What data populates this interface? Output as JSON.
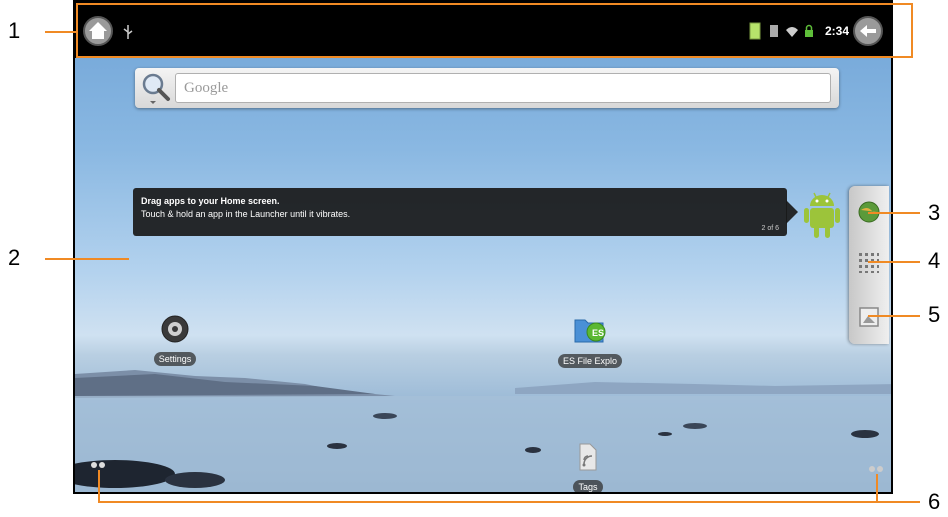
{
  "callouts": [
    "1",
    "2",
    "3",
    "4",
    "5",
    "6"
  ],
  "status_bar": {
    "time": "2:34",
    "icons": [
      "home-icon",
      "usb-icon",
      "battery-icon",
      "sd-card-icon",
      "wifi-icon",
      "lock-icon",
      "back-icon"
    ]
  },
  "search": {
    "placeholder": "Google"
  },
  "tip": {
    "title": "Drag apps to your Home screen.",
    "body": "Touch & hold an app in the Launcher until it vibrates.",
    "page": "2 of 6"
  },
  "apps": [
    {
      "label": "Settings",
      "icon": "settings-icon"
    },
    {
      "label": "ES File Explo",
      "icon": "es-file-explorer-icon"
    },
    {
      "label": "Tags",
      "icon": "tags-icon"
    }
  ],
  "sidebar": {
    "buttons": [
      "browser-icon",
      "app-launcher-icon",
      "wallpaper-icon"
    ]
  },
  "colors": {
    "callout_line": "#f08a24",
    "status_bar": "#000000",
    "sky": "#8ab8e2"
  }
}
